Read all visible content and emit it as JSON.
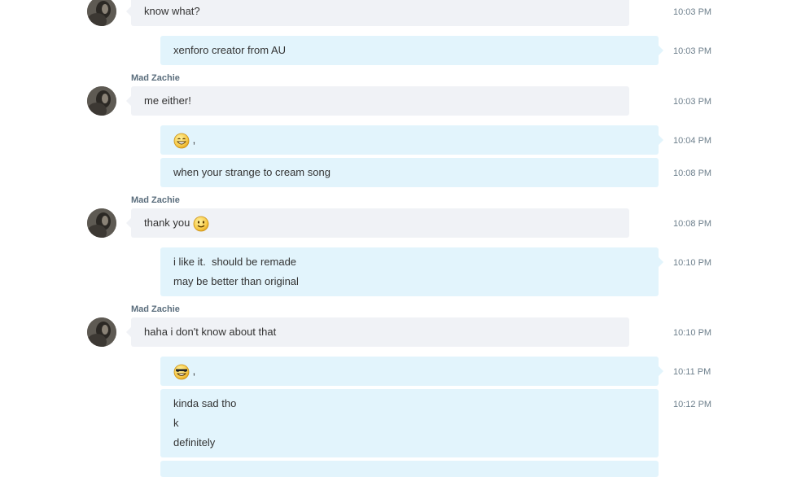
{
  "messages": [
    {
      "sender": "",
      "lines": [
        "know what?"
      ],
      "time": "10:03 PM",
      "outgoing": false
    },
    {
      "sender": "",
      "lines": [
        "xenforo creator from AU"
      ],
      "time": "10:03 PM",
      "outgoing": true
    },
    {
      "sender": "Mad Zachie",
      "lines": [
        "me either!"
      ],
      "time": "10:03 PM",
      "outgoing": false
    },
    {
      "sender": "",
      "emoji": "grinning-face-emoji",
      "suffix": ",",
      "time": "10:04 PM",
      "outgoing": true
    },
    {
      "sender": "",
      "lines": [
        "when your strange to cream song"
      ],
      "time": "10:08 PM",
      "outgoing": true
    },
    {
      "sender": "Mad Zachie",
      "lines": [
        "thank you"
      ],
      "emoji": "smiley-face-emoji",
      "time": "10:08 PM",
      "outgoing": false
    },
    {
      "sender": "",
      "lines": [
        "i like it.  should be remade",
        "may be better than original"
      ],
      "time": "10:10 PM",
      "outgoing": true
    },
    {
      "sender": "Mad Zachie",
      "lines": [
        "haha i don't know about that"
      ],
      "time": "10:10 PM",
      "outgoing": false
    },
    {
      "sender": "",
      "emoji": "cool-face-emoji",
      "suffix": ",",
      "time": "10:11 PM",
      "outgoing": true
    },
    {
      "sender": "",
      "lines": [
        "kinda sad tho",
        "k",
        "definitely"
      ],
      "time": "10:12 PM",
      "outgoing": true
    }
  ],
  "colors": {
    "incoming_bubble": "#f0f2f6",
    "outgoing_bubble": "#e2f4fc",
    "sender_name": "#5b6e7d",
    "timestamp": "#6d7f8c"
  }
}
